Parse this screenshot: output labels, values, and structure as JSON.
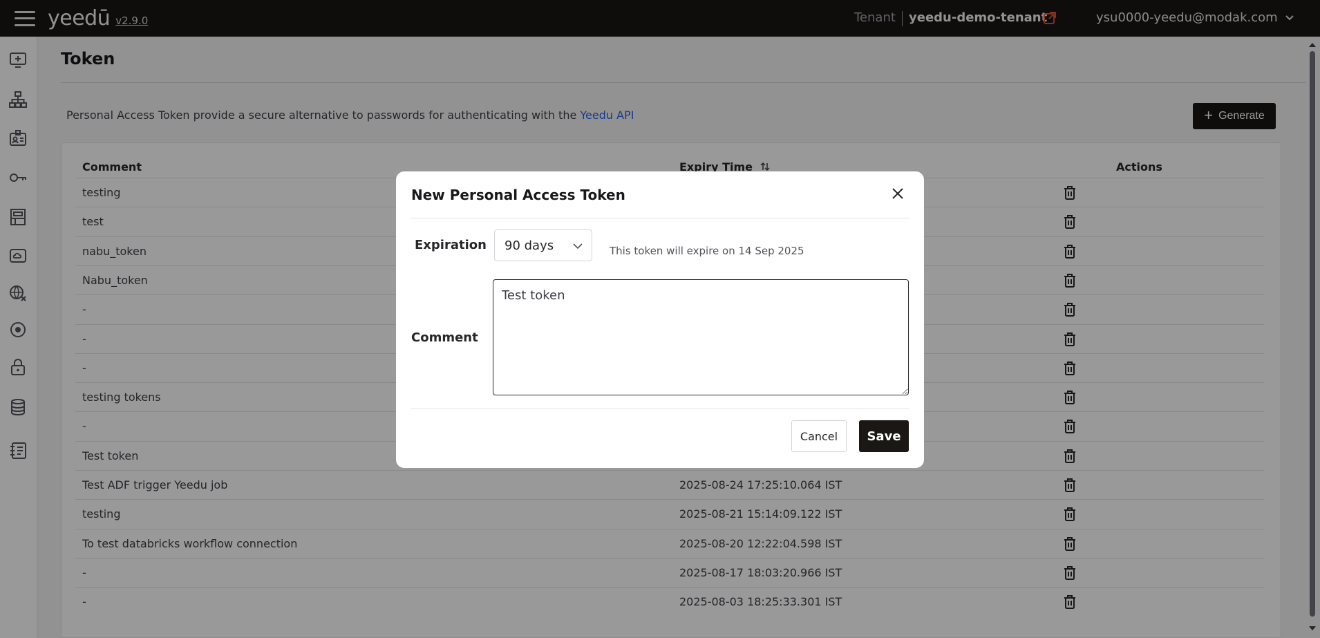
{
  "topbar": {
    "logo": "yeedū",
    "version": "v2.9.0",
    "tenant_label": "Tenant",
    "tenant_name": "yeedu-demo-tenant",
    "user": "ysu0000-yeedu@modak.com"
  },
  "sidebar": {
    "items": [
      {
        "icon": "add-screen-icon"
      },
      {
        "icon": "hierarchy-icon"
      },
      {
        "icon": "id-card-icon"
      },
      {
        "icon": "key-icon"
      },
      {
        "icon": "rack-icon"
      },
      {
        "icon": "cloud-drive-icon"
      },
      {
        "icon": "globe-icon"
      },
      {
        "icon": "target-icon"
      },
      {
        "icon": "lock-icon"
      },
      {
        "icon": "database-icon"
      },
      {
        "icon": "notebook-icon"
      }
    ]
  },
  "page": {
    "title": "Token",
    "description": "Personal Access Token provide a secure alternative to passwords for authenticating with the ",
    "description_link": "Yeedu API",
    "generate_label": "Generate"
  },
  "table": {
    "headers": {
      "comment": "Comment",
      "expiry": "Expiry Time",
      "actions": "Actions"
    },
    "rows": [
      {
        "comment": "testing",
        "expiry": ""
      },
      {
        "comment": "test",
        "expiry": ""
      },
      {
        "comment": "nabu_token",
        "expiry": ""
      },
      {
        "comment": "Nabu_token",
        "expiry": ""
      },
      {
        "comment": "-",
        "expiry": ""
      },
      {
        "comment": "-",
        "expiry": ""
      },
      {
        "comment": "-",
        "expiry": ""
      },
      {
        "comment": "testing tokens",
        "expiry": ""
      },
      {
        "comment": "-",
        "expiry": ""
      },
      {
        "comment": "Test token",
        "expiry": ""
      },
      {
        "comment": "Test ADF trigger Yeedu job",
        "expiry": "2025-08-24 17:25:10.064 IST"
      },
      {
        "comment": "testing",
        "expiry": "2025-08-21 15:14:09.122 IST"
      },
      {
        "comment": "To test databricks workflow connection",
        "expiry": "2025-08-20 12:22:04.598 IST"
      },
      {
        "comment": "-",
        "expiry": "2025-08-17 18:03:20.966 IST"
      },
      {
        "comment": "-",
        "expiry": "2025-08-03 18:25:33.301 IST"
      }
    ]
  },
  "modal": {
    "title": "New Personal Access Token",
    "expiration_label": "Expiration",
    "expiration_value": "90 days",
    "expiration_note": "This token will expire on 14 Sep 2025",
    "comment_label": "Comment",
    "comment_value": "Test token",
    "cancel_label": "Cancel",
    "save_label": "Save"
  },
  "colors": {
    "topbar": "#1a1714",
    "link": "#2563eb",
    "external_icon": "#e0532b"
  }
}
